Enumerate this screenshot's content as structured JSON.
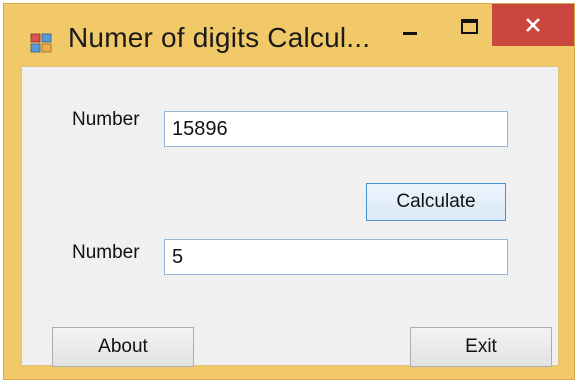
{
  "window": {
    "title": "Numer of digits Calcul..."
  },
  "form": {
    "number_label": "Number",
    "number_value": "15896",
    "result_label": "Number",
    "result_value": "5"
  },
  "buttons": {
    "calculate": "Calculate",
    "about": "About",
    "exit": "Exit"
  },
  "colors": {
    "titlebar": "#f2c969",
    "close_button": "#c9473f",
    "client_background": "#f0f0f0",
    "focus_border": "#4a90d9"
  },
  "icons": {
    "app": "form-icon",
    "minimize": "minimize-icon",
    "maximize": "maximize-icon",
    "close": "close-icon"
  }
}
